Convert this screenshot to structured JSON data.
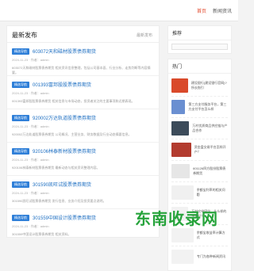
{
  "nav": {
    "home": "首页",
    "item2": "新闻资讯"
  },
  "main": {
    "title": "最新发布",
    "link": "最新发布",
    "posts": [
      {
        "tag": "精选导航",
        "title": "603072天和磁材股票债券期货",
        "meta": "2024-11-23 · 作者：admin",
        "excerpt": "603072天和磁材股票债券期货 相关资讯信息整理，包括公司基本面、行业分析、走势判断等内容摘要。"
      },
      {
        "tag": "精选导航",
        "title": "001393富邦股股票债券期货",
        "meta": "2024-11-23 · 作者：admin",
        "excerpt": "001393富邦股股票债券期货 相关信息与市场动态，投资者关注的主要事项和近期表现。"
      },
      {
        "tag": "精选导航",
        "title": "920002万达轨道股票债券期货",
        "meta": "2024-11-23 · 作者：admin",
        "excerpt": "920002万达轨道股票债券期货 公司概况、主营业务、财务数据及行业动态摘要信息。"
      },
      {
        "tag": "精选导航",
        "title": "920106林泰新材股票债券期货",
        "meta": "2024-11-23 · 作者：admin",
        "excerpt": "920106林泰新材股票债券期货 最新动态与相关资讯整理内容。"
      },
      {
        "tag": "精选导航",
        "title": "301590凯旺试股票债券期货",
        "meta": "2024-11-23 · 作者：admin",
        "excerpt": "301590凯旺试股票债券期货 发行信息、业务介绍及投资要点说明。"
      },
      {
        "tag": "精选导航",
        "title": "301559中国设计股票债券期货",
        "meta": "2024-11-23 · 作者：admin",
        "excerpt": "301559中国设计股票债券期货 相关资料。"
      }
    ]
  },
  "side": {
    "search_title": "推荐",
    "hot_title": "热门",
    "hot_items": [
      {
        "text": "建设银行(建设银行官网)? 所长指引",
        "color": "#d94a2b"
      },
      {
        "text": "第三方支付服务平台，第三方支付平台怎么样",
        "color": "#6a8fd1"
      },
      {
        "text": "万村优质商品供应链与产品合作",
        "color": "#3c4b5a"
      },
      {
        "text": "资金盘交易平台怎样开户？",
        "color": "#b33c2f"
      },
      {
        "text": "601126四方股份股票债券期货",
        "color": "#e6e6e6"
      },
      {
        "text": "余额宝利率的相关问题",
        "color": "#f0f0f0"
      },
      {
        "text": "万村交给网站，什么样的平台好？",
        "color": "#f2f2f2"
      },
      {
        "text": "余额宝收益率计算方式",
        "color": "#f2f2f2"
      },
      {
        "text": "专门为各种新闻资讯",
        "color": "#f2f2f2"
      }
    ]
  },
  "watermark": {
    "text": "东南收录网"
  }
}
